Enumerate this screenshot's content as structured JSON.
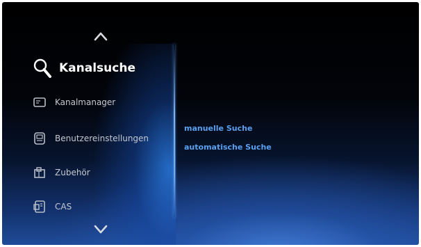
{
  "menu": {
    "items": [
      {
        "label": "Kanalsuche",
        "icon": "search-icon",
        "active": true
      },
      {
        "label": "Kanalmanager",
        "icon": "channel-manager-icon",
        "active": false
      },
      {
        "label": "Benutzereinstellungen",
        "icon": "user-settings-icon",
        "active": false
      },
      {
        "label": "Zubehör",
        "icon": "accessories-icon",
        "active": false
      },
      {
        "label": "CAS",
        "icon": "cas-card-icon",
        "active": false
      }
    ],
    "scroll_up_icon": "chevron-up-icon",
    "scroll_down_icon": "chevron-down-icon"
  },
  "submenu": {
    "items": [
      {
        "label": "manuelle Suche"
      },
      {
        "label": "automatische Suche"
      }
    ]
  },
  "colors": {
    "active_label": "#ffffff",
    "inactive_label": "#c4c8d0",
    "submenu_label": "#5aa0f0",
    "background_top": "#000000",
    "background_bottom": "#1f4b98"
  }
}
